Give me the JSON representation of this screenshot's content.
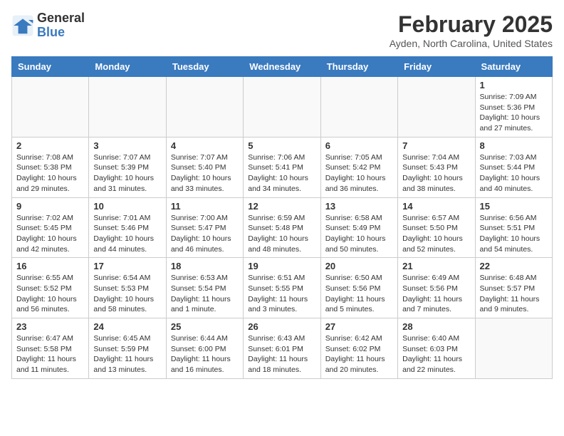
{
  "logo": {
    "line1": "General",
    "line2": "Blue"
  },
  "header": {
    "month": "February 2025",
    "location": "Ayden, North Carolina, United States"
  },
  "weekdays": [
    "Sunday",
    "Monday",
    "Tuesday",
    "Wednesday",
    "Thursday",
    "Friday",
    "Saturday"
  ],
  "weeks": [
    [
      {
        "day": "",
        "info": ""
      },
      {
        "day": "",
        "info": ""
      },
      {
        "day": "",
        "info": ""
      },
      {
        "day": "",
        "info": ""
      },
      {
        "day": "",
        "info": ""
      },
      {
        "day": "",
        "info": ""
      },
      {
        "day": "1",
        "info": "Sunrise: 7:09 AM\nSunset: 5:36 PM\nDaylight: 10 hours and 27 minutes."
      }
    ],
    [
      {
        "day": "2",
        "info": "Sunrise: 7:08 AM\nSunset: 5:38 PM\nDaylight: 10 hours and 29 minutes."
      },
      {
        "day": "3",
        "info": "Sunrise: 7:07 AM\nSunset: 5:39 PM\nDaylight: 10 hours and 31 minutes."
      },
      {
        "day": "4",
        "info": "Sunrise: 7:07 AM\nSunset: 5:40 PM\nDaylight: 10 hours and 33 minutes."
      },
      {
        "day": "5",
        "info": "Sunrise: 7:06 AM\nSunset: 5:41 PM\nDaylight: 10 hours and 34 minutes."
      },
      {
        "day": "6",
        "info": "Sunrise: 7:05 AM\nSunset: 5:42 PM\nDaylight: 10 hours and 36 minutes."
      },
      {
        "day": "7",
        "info": "Sunrise: 7:04 AM\nSunset: 5:43 PM\nDaylight: 10 hours and 38 minutes."
      },
      {
        "day": "8",
        "info": "Sunrise: 7:03 AM\nSunset: 5:44 PM\nDaylight: 10 hours and 40 minutes."
      }
    ],
    [
      {
        "day": "9",
        "info": "Sunrise: 7:02 AM\nSunset: 5:45 PM\nDaylight: 10 hours and 42 minutes."
      },
      {
        "day": "10",
        "info": "Sunrise: 7:01 AM\nSunset: 5:46 PM\nDaylight: 10 hours and 44 minutes."
      },
      {
        "day": "11",
        "info": "Sunrise: 7:00 AM\nSunset: 5:47 PM\nDaylight: 10 hours and 46 minutes."
      },
      {
        "day": "12",
        "info": "Sunrise: 6:59 AM\nSunset: 5:48 PM\nDaylight: 10 hours and 48 minutes."
      },
      {
        "day": "13",
        "info": "Sunrise: 6:58 AM\nSunset: 5:49 PM\nDaylight: 10 hours and 50 minutes."
      },
      {
        "day": "14",
        "info": "Sunrise: 6:57 AM\nSunset: 5:50 PM\nDaylight: 10 hours and 52 minutes."
      },
      {
        "day": "15",
        "info": "Sunrise: 6:56 AM\nSunset: 5:51 PM\nDaylight: 10 hours and 54 minutes."
      }
    ],
    [
      {
        "day": "16",
        "info": "Sunrise: 6:55 AM\nSunset: 5:52 PM\nDaylight: 10 hours and 56 minutes."
      },
      {
        "day": "17",
        "info": "Sunrise: 6:54 AM\nSunset: 5:53 PM\nDaylight: 10 hours and 58 minutes."
      },
      {
        "day": "18",
        "info": "Sunrise: 6:53 AM\nSunset: 5:54 PM\nDaylight: 11 hours and 1 minute."
      },
      {
        "day": "19",
        "info": "Sunrise: 6:51 AM\nSunset: 5:55 PM\nDaylight: 11 hours and 3 minutes."
      },
      {
        "day": "20",
        "info": "Sunrise: 6:50 AM\nSunset: 5:56 PM\nDaylight: 11 hours and 5 minutes."
      },
      {
        "day": "21",
        "info": "Sunrise: 6:49 AM\nSunset: 5:56 PM\nDaylight: 11 hours and 7 minutes."
      },
      {
        "day": "22",
        "info": "Sunrise: 6:48 AM\nSunset: 5:57 PM\nDaylight: 11 hours and 9 minutes."
      }
    ],
    [
      {
        "day": "23",
        "info": "Sunrise: 6:47 AM\nSunset: 5:58 PM\nDaylight: 11 hours and 11 minutes."
      },
      {
        "day": "24",
        "info": "Sunrise: 6:45 AM\nSunset: 5:59 PM\nDaylight: 11 hours and 13 minutes."
      },
      {
        "day": "25",
        "info": "Sunrise: 6:44 AM\nSunset: 6:00 PM\nDaylight: 11 hours and 16 minutes."
      },
      {
        "day": "26",
        "info": "Sunrise: 6:43 AM\nSunset: 6:01 PM\nDaylight: 11 hours and 18 minutes."
      },
      {
        "day": "27",
        "info": "Sunrise: 6:42 AM\nSunset: 6:02 PM\nDaylight: 11 hours and 20 minutes."
      },
      {
        "day": "28",
        "info": "Sunrise: 6:40 AM\nSunset: 6:03 PM\nDaylight: 11 hours and 22 minutes."
      },
      {
        "day": "",
        "info": ""
      }
    ]
  ]
}
